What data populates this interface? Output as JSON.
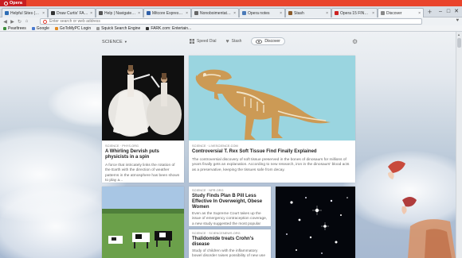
{
  "window": {
    "app_button": "Opera",
    "controls": [
      "–",
      "□",
      "✕"
    ]
  },
  "tabs": [
    {
      "label": "Helpful Sites (b.com",
      "color": "#2d6db5"
    },
    {
      "label": "Draw Curtis' FARK.com",
      "color": "#333333"
    },
    {
      "label": "Help | Navigate with...",
      "color": "#555555"
    },
    {
      "label": "Mitcore Express the...",
      "color": "#2f5fa8"
    },
    {
      "label": "Nonoboimentator: Fo...",
      "color": "#666666"
    },
    {
      "label": "Opera notes",
      "color": "#4a7ab8"
    },
    {
      "label": "Stash",
      "color": "#8a5a2a"
    },
    {
      "label": "Opera 15 FINAL Re...",
      "color": "#cc2222"
    },
    {
      "label": "Discover",
      "color": "#888888"
    }
  ],
  "navigation": {
    "back": "◀",
    "forward": "▶",
    "reload": "↻",
    "home": "⌂",
    "address_placeholder": "Enter search or web address",
    "right_icon": "♥"
  },
  "bookmarks": [
    {
      "label": "Pearltrees",
      "color": "#3a8d3a"
    },
    {
      "label": "Google",
      "color": "#4a7ad0"
    },
    {
      "label": "GoToMyPC Login",
      "color": "#e48a20"
    },
    {
      "label": "Squick Search Engine",
      "color": "#999999"
    },
    {
      "label": "FARK.com: Entertain...",
      "color": "#333333"
    }
  ],
  "discover": {
    "category": "SCIENCE",
    "modes": [
      {
        "label": "Speed Dial",
        "icon": "grid-icon"
      },
      {
        "label": "Stash",
        "icon": "heart-icon"
      },
      {
        "label": "Discover",
        "icon": "eye-icon",
        "active": true
      }
    ]
  },
  "articles": [
    {
      "source": "SCIENCE · PHYS.ORG",
      "title": "A Whirling Dervish puts physicists in a spin",
      "summary": "A force that intricately links the rotation of the Earth with the direction of weather patterns in the atmosphere has been shown to play a..."
    },
    {
      "source": "SCIENCE · LIVESCIENCE.COM",
      "title": "Controversial T. Rex Soft Tissue Find Finally Explained",
      "summary": "The controversial discovery of soft tissue preserved in the bones of dinosaurs for millions of years finally gets an explanation. According to new research, iron in the dinosaurs' blood acts as a preservative, keeping the tissues safe from decay."
    },
    {
      "source": "SCIENCE · NPR.ORG",
      "title": "Study Finds Plan B Pill Less Effective In Overweight, Obese Women",
      "summary": "Even as the Supreme Court takes up the issue of emergency contraception coverage, a new study suggested the most popular form of the..."
    },
    {
      "source": "SCIENCE · SCIENCENEWS.ORG",
      "title": "Thalidomide treats Crohn's disease",
      "summary": "Study of children with the inflammatory bowel disorder raises possibility of new use for tainted..."
    }
  ]
}
